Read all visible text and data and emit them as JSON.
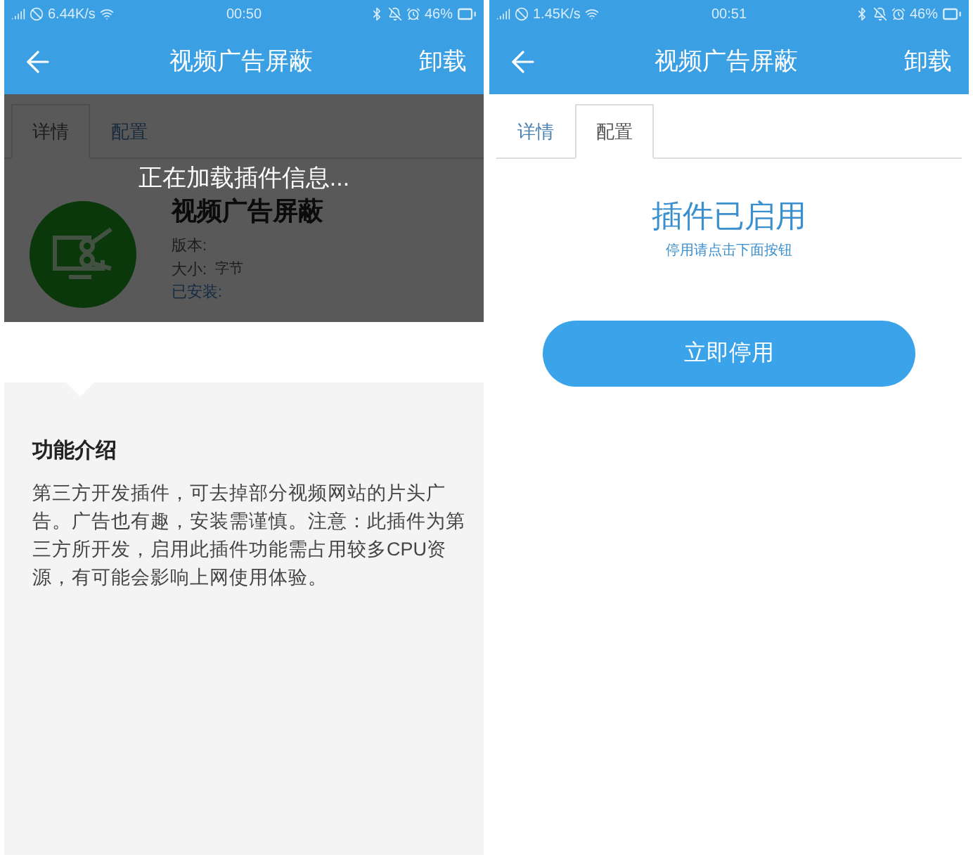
{
  "screens": [
    {
      "kind": "details",
      "status_bar": {
        "speed": "6.44K/s",
        "time": "00:50",
        "battery": "46%"
      },
      "app_bar": {
        "title": "视频广告屏蔽",
        "action": "卸载"
      },
      "tabs": [
        {
          "label": "详情",
          "selected": true
        },
        {
          "label": "配置",
          "selected": false
        }
      ],
      "loading": {
        "text": "正在加载插件信息..."
      },
      "plugin": {
        "name": "视频广告屏蔽",
        "version_label": "版本:",
        "size_label": "大小:",
        "size_unit": "字节",
        "installed": "已安装:"
      },
      "intro": {
        "heading": "功能介绍",
        "body": "第三方开发插件，可去掉部分视频网站的片头广告。广告也有趣，安装需谨慎。注意：此插件为第三方所开发，启用此插件功能需占用较多CPU资源，有可能会影响上网使用体验。"
      }
    },
    {
      "kind": "config",
      "status_bar": {
        "speed": "1.45K/s",
        "time": "00:51",
        "battery": "46%"
      },
      "app_bar": {
        "title": "视频广告屏蔽",
        "action": "卸载"
      },
      "tabs": [
        {
          "label": "详情",
          "selected": false
        },
        {
          "label": "配置",
          "selected": true
        }
      ],
      "status": {
        "title": "插件已启用",
        "hint": "停用请点击下面按钮"
      },
      "button": {
        "label": "立即停用"
      }
    }
  ]
}
